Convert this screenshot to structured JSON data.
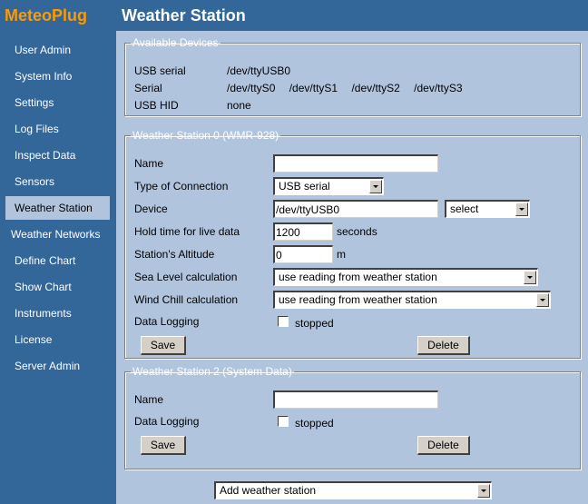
{
  "app": {
    "logo": "MeteoPlug",
    "page_title": "Weather Station"
  },
  "sidebar": {
    "items": [
      {
        "label": "User Admin"
      },
      {
        "label": "System Info"
      },
      {
        "label": "Settings"
      },
      {
        "label": "Log Files"
      },
      {
        "label": "Inspect Data"
      },
      {
        "label": "Sensors"
      },
      {
        "label": "Weather Station",
        "active": true
      },
      {
        "label": "Weather Networks"
      },
      {
        "label": "Define Chart"
      },
      {
        "label": "Show Chart"
      },
      {
        "label": "Instruments"
      },
      {
        "label": "License"
      },
      {
        "label": "Server Admin"
      }
    ]
  },
  "devices": {
    "legend": "Available Devices",
    "rows": [
      {
        "label": "USB serial",
        "values": [
          "/dev/ttyUSB0"
        ]
      },
      {
        "label": "Serial",
        "values": [
          "/dev/ttyS0",
          "/dev/ttyS1",
          "/dev/ttyS2",
          "/dev/ttyS3"
        ]
      },
      {
        "label": "USB HID",
        "values": [
          "none"
        ]
      }
    ]
  },
  "station0": {
    "legend": "Weather Station 0 (WMR-928)",
    "name_label": "Name",
    "name_value": "",
    "connection_label": "Type of Connection",
    "connection_value": "USB serial",
    "device_label": "Device",
    "device_value": "/dev/ttyUSB0",
    "device_select": "select",
    "hold_label": "Hold time for live data",
    "hold_value": "1200",
    "hold_unit": "seconds",
    "altitude_label": "Station's Altitude",
    "altitude_value": "0",
    "altitude_unit": "m",
    "sealevel_label": "Sea Level calculation",
    "sealevel_value": "use reading from weather station",
    "windchill_label": "Wind Chill calculation",
    "windchill_value": "use reading from weather station",
    "logging_label": "Data Logging",
    "logging_checked": false,
    "logging_status": "stopped",
    "save_label": "Save",
    "delete_label": "Delete"
  },
  "station2": {
    "legend": "Weather Station 2 (System Data)",
    "name_label": "Name",
    "name_value": "",
    "logging_label": "Data Logging",
    "logging_checked": false,
    "logging_status": "stopped",
    "save_label": "Save",
    "delete_label": "Delete"
  },
  "add_station": {
    "value": "Add weather station"
  },
  "colors": {
    "sidebar_bg": "#336699",
    "content_bg": "#b0c4de",
    "logo": "#ff9900",
    "button_face": "#d4d0c8"
  }
}
